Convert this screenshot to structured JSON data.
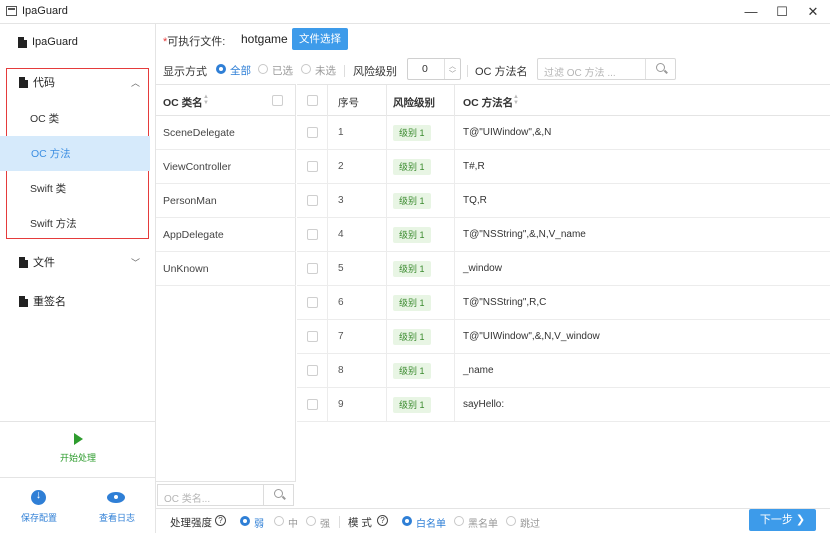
{
  "window": {
    "title": "IpaGuard",
    "controls": {
      "minimize": "—",
      "maximize": "☐",
      "close": "✕"
    }
  },
  "sidebar": {
    "brand": "IpaGuard",
    "code_group": {
      "label": "代码",
      "expanded": true
    },
    "code_items": [
      {
        "label": "OC 类",
        "active": false
      },
      {
        "label": "OC 方法",
        "active": true
      },
      {
        "label": "Swift 类",
        "active": false
      },
      {
        "label": "Swift 方法",
        "active": false
      }
    ],
    "file_group": {
      "label": "文件",
      "expanded": false
    },
    "resign": {
      "label": "重签名"
    },
    "start_button": "开始处理",
    "save_config": "保存配置",
    "view_log": "查看日志"
  },
  "executable": {
    "required_mark": "*",
    "label": "可执行文件:",
    "value": "hotgame",
    "select_button": "文件选择"
  },
  "filters": {
    "display_label": "显示方式",
    "display_options": [
      {
        "label": "全部",
        "selected": true
      },
      {
        "label": "已选",
        "selected": false
      },
      {
        "label": "未选",
        "selected": false
      }
    ],
    "risk_label": "风险级别",
    "risk_value": "0",
    "method_search_label": "OC 方法名",
    "method_search_placeholder": "过滤 OC 方法 ..."
  },
  "class_panel": {
    "header": "OC 类名",
    "classes": [
      "SceneDelegate",
      "ViewController",
      "PersonMan",
      "AppDelegate",
      "UnKnown"
    ],
    "search_placeholder": "OC 类名..."
  },
  "methods_table": {
    "columns": {
      "index": "序号",
      "risk": "风险级别",
      "name": "OC 方法名"
    },
    "rows": [
      {
        "index": "1",
        "risk": "级别 1",
        "name": "T@\"UIWindow\",&,N"
      },
      {
        "index": "2",
        "risk": "级别 1",
        "name": "T#,R"
      },
      {
        "index": "3",
        "risk": "级别 1",
        "name": "TQ,R"
      },
      {
        "index": "4",
        "risk": "级别 1",
        "name": "T@\"NSString\",&,N,V_name"
      },
      {
        "index": "5",
        "risk": "级别 1",
        "name": "_window"
      },
      {
        "index": "6",
        "risk": "级别 1",
        "name": "T@\"NSString\",R,C"
      },
      {
        "index": "7",
        "risk": "级别 1",
        "name": "T@\"UIWindow\",&,N,V_window"
      },
      {
        "index": "8",
        "risk": "级别 1",
        "name": "_name"
      },
      {
        "index": "9",
        "risk": "级别 1",
        "name": "sayHello:"
      }
    ]
  },
  "bottom_bar": {
    "strength_label": "处理强度",
    "help_glyph": "?",
    "strength_options": [
      {
        "label": "弱",
        "selected": true
      },
      {
        "label": "中",
        "selected": false
      },
      {
        "label": "强",
        "selected": false
      }
    ],
    "mode_label": "模 式",
    "mode_options": [
      {
        "label": "白名单",
        "selected": true
      },
      {
        "label": "黑名单",
        "selected": false
      },
      {
        "label": "跳过",
        "selected": false
      }
    ],
    "next_button": "下一步 ❯"
  },
  "colors": {
    "accent": "#3d9bea",
    "highlight_border": "#e53b3b",
    "badge_bg": "#e8f5e4",
    "start_green": "#2e9c2e"
  }
}
